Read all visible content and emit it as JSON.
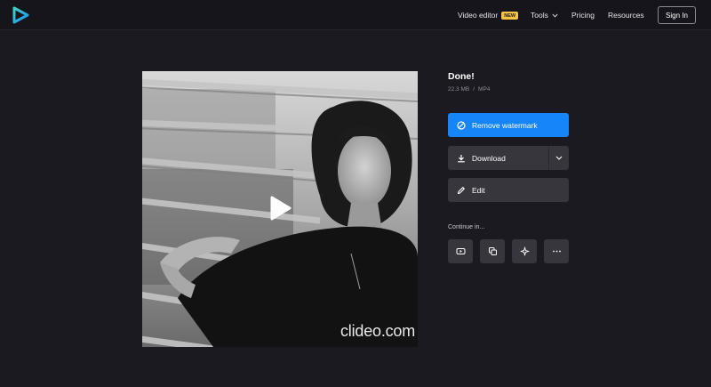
{
  "header": {
    "nav": {
      "video_editor": "Video editor",
      "video_editor_badge": "NEW",
      "tools": "Tools",
      "pricing": "Pricing",
      "resources": "Resources"
    },
    "sign_in": "Sign In",
    "logo_icon": "play-logo-icon"
  },
  "preview": {
    "watermark": "clideo.com",
    "play_icon": "play-icon"
  },
  "result": {
    "title": "Done!",
    "size": "22.3 MB",
    "separator": "/",
    "format": "MP4"
  },
  "actions": {
    "remove_watermark": "Remove watermark",
    "download": "Download",
    "edit": "Edit"
  },
  "continue": {
    "label": "Continue in...",
    "tools": [
      "youtube-icon",
      "merge-icon",
      "ai-sparkle-icon",
      "more-icon"
    ]
  },
  "colors": {
    "background": "#1b1a21",
    "primary_button": "#1685f8",
    "secondary_button": "#37363d",
    "badge": "#f6c445"
  }
}
